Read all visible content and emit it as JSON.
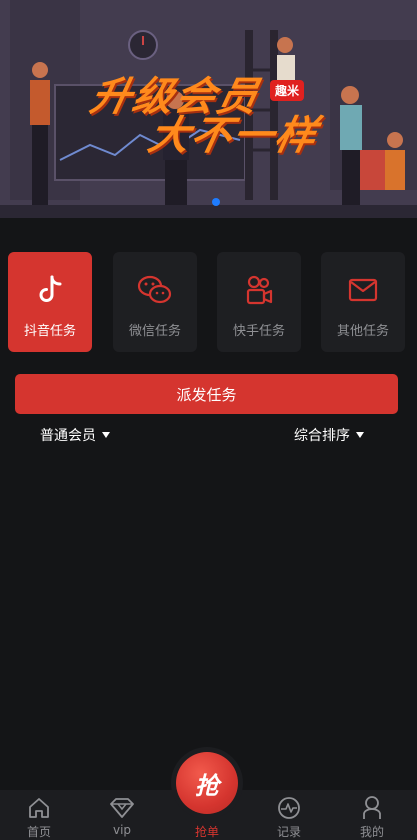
{
  "banner": {
    "title_line1": "升级会员",
    "title_line2": "大不一样",
    "tag": "趣米"
  },
  "categories": [
    {
      "label": "抖音任务",
      "icon": "tiktok-icon",
      "active": true
    },
    {
      "label": "微信任务",
      "icon": "wechat-icon",
      "active": false
    },
    {
      "label": "快手任务",
      "icon": "kuaishou-icon",
      "active": false
    },
    {
      "label": "其他任务",
      "icon": "mail-icon",
      "active": false
    }
  ],
  "dispatch_button": "派发任务",
  "filters": {
    "member_level": "普通会员",
    "sort": "综合排序"
  },
  "tabbar": {
    "home": "首页",
    "vip": "vip",
    "grab": "抢单",
    "grab_button": "抢",
    "records": "记录",
    "mine": "我的"
  },
  "colors": {
    "accent": "#d5352f",
    "background": "#141517",
    "card": "#1e1f22",
    "dot": "#1e7cff"
  }
}
